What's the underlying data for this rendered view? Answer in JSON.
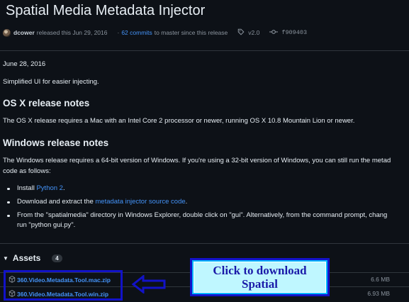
{
  "release": {
    "title": "Spatial Media Metadata Injector",
    "author": "dcower",
    "released_text": "released this Jun 29, 2016",
    "commits_link": "62 commits",
    "commits_suffix": "to master since this release",
    "tag": "v2.0",
    "commit_hash": "f909403"
  },
  "notes": {
    "date": "June 28, 2016",
    "summary": "Simplified UI for easier injecting.",
    "osx_heading": "OS X release notes",
    "osx_text": "The OS X release requires a Mac with an Intel Core 2 processor or newer, running OS X 10.8 Mountain Lion or newer.",
    "win_heading": "Windows release notes",
    "win_text_line1": "The Windows release requires a 64-bit version of Windows. If you're using a 32-bit version of Windows, you can still run the metad",
    "win_text_line2": "code as follows:",
    "steps": [
      {
        "prefix": "Install ",
        "link": "Python 2",
        "suffix": "."
      },
      {
        "prefix": "Download and extract the ",
        "link": "metadata injector source code",
        "suffix": "."
      },
      {
        "line1": "From the \"spatialmedia\" directory in Windows Explorer, double click on \"gui\". Alternatively, from the command prompt, chang",
        "line2": "run \"python gui.py\"."
      }
    ]
  },
  "assets": {
    "heading": "Assets",
    "count": "4",
    "items": [
      {
        "name": "360.Video.Metadata.Tool.mac.zip",
        "size": "6.6 MB"
      },
      {
        "name": "360.Video.Metadata.Tool.win.zip",
        "size": "6.93 MB"
      }
    ]
  },
  "annotation": {
    "line1": "Click to download",
    "line2": "Spatial"
  },
  "colors": {
    "background": "#0d1117",
    "link": "#4493f8",
    "annotation_border": "#1212c8",
    "annotation_fill": "#bff7ff"
  }
}
